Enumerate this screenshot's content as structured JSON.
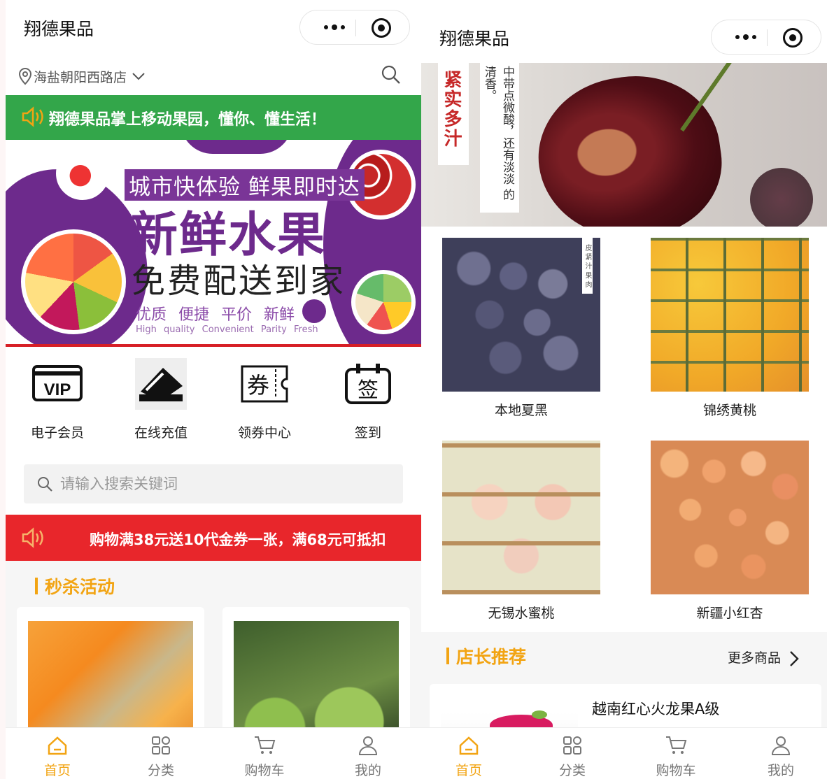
{
  "left": {
    "header": {
      "title": "翔德果品"
    },
    "location": {
      "store": "海盐朝阳西路店"
    },
    "notice_green": "翔德果品掌上移动果园，懂你、懂生活！",
    "banner": {
      "line1": "城市快体验 鲜果即时达",
      "line2": "新鲜水果",
      "line3": "免费配送到家",
      "line4": "优质 便捷 平价 新鲜",
      "line5": "High quality Convenient Parity Fresh"
    },
    "shortcuts": [
      {
        "label": "电子会员",
        "icon": "vip-card-icon"
      },
      {
        "label": "在线充值",
        "icon": "credit-card-icon"
      },
      {
        "label": "领券中心",
        "icon": "coupon-icon"
      },
      {
        "label": "签到",
        "icon": "calendar-sign-icon"
      }
    ],
    "search": {
      "placeholder": "请输入搜索关键词"
    },
    "notice_red": "购物满38元送10代金券一张，满68元可抵扣",
    "flash_sale": {
      "title": "秒杀活动"
    }
  },
  "right": {
    "header": {
      "title": "翔德果品"
    },
    "banner": {
      "caption_red": "紧实多汁",
      "caption_col1": "中带点微酸，还有淡淡",
      "caption_col2": "的清香。",
      "caption_small": "皮 紧 汁 果 肉"
    },
    "products": [
      {
        "name": "本地夏黑"
      },
      {
        "name": "锦绣黄桃"
      },
      {
        "name": "无锡水蜜桃"
      },
      {
        "name": "新疆小红杏"
      }
    ],
    "recommend": {
      "title": "店长推荐",
      "more": "更多商品",
      "first_item": "越南红心火龙果A级"
    }
  },
  "tabbar": [
    {
      "label": "首页",
      "icon": "home-icon"
    },
    {
      "label": "分类",
      "icon": "category-icon"
    },
    {
      "label": "购物车",
      "icon": "cart-icon"
    },
    {
      "label": "我的",
      "icon": "user-icon"
    }
  ],
  "colors": {
    "accent": "#f2a413",
    "green": "#33a64a",
    "red": "#e8262b",
    "purple": "#6d2a8c"
  }
}
